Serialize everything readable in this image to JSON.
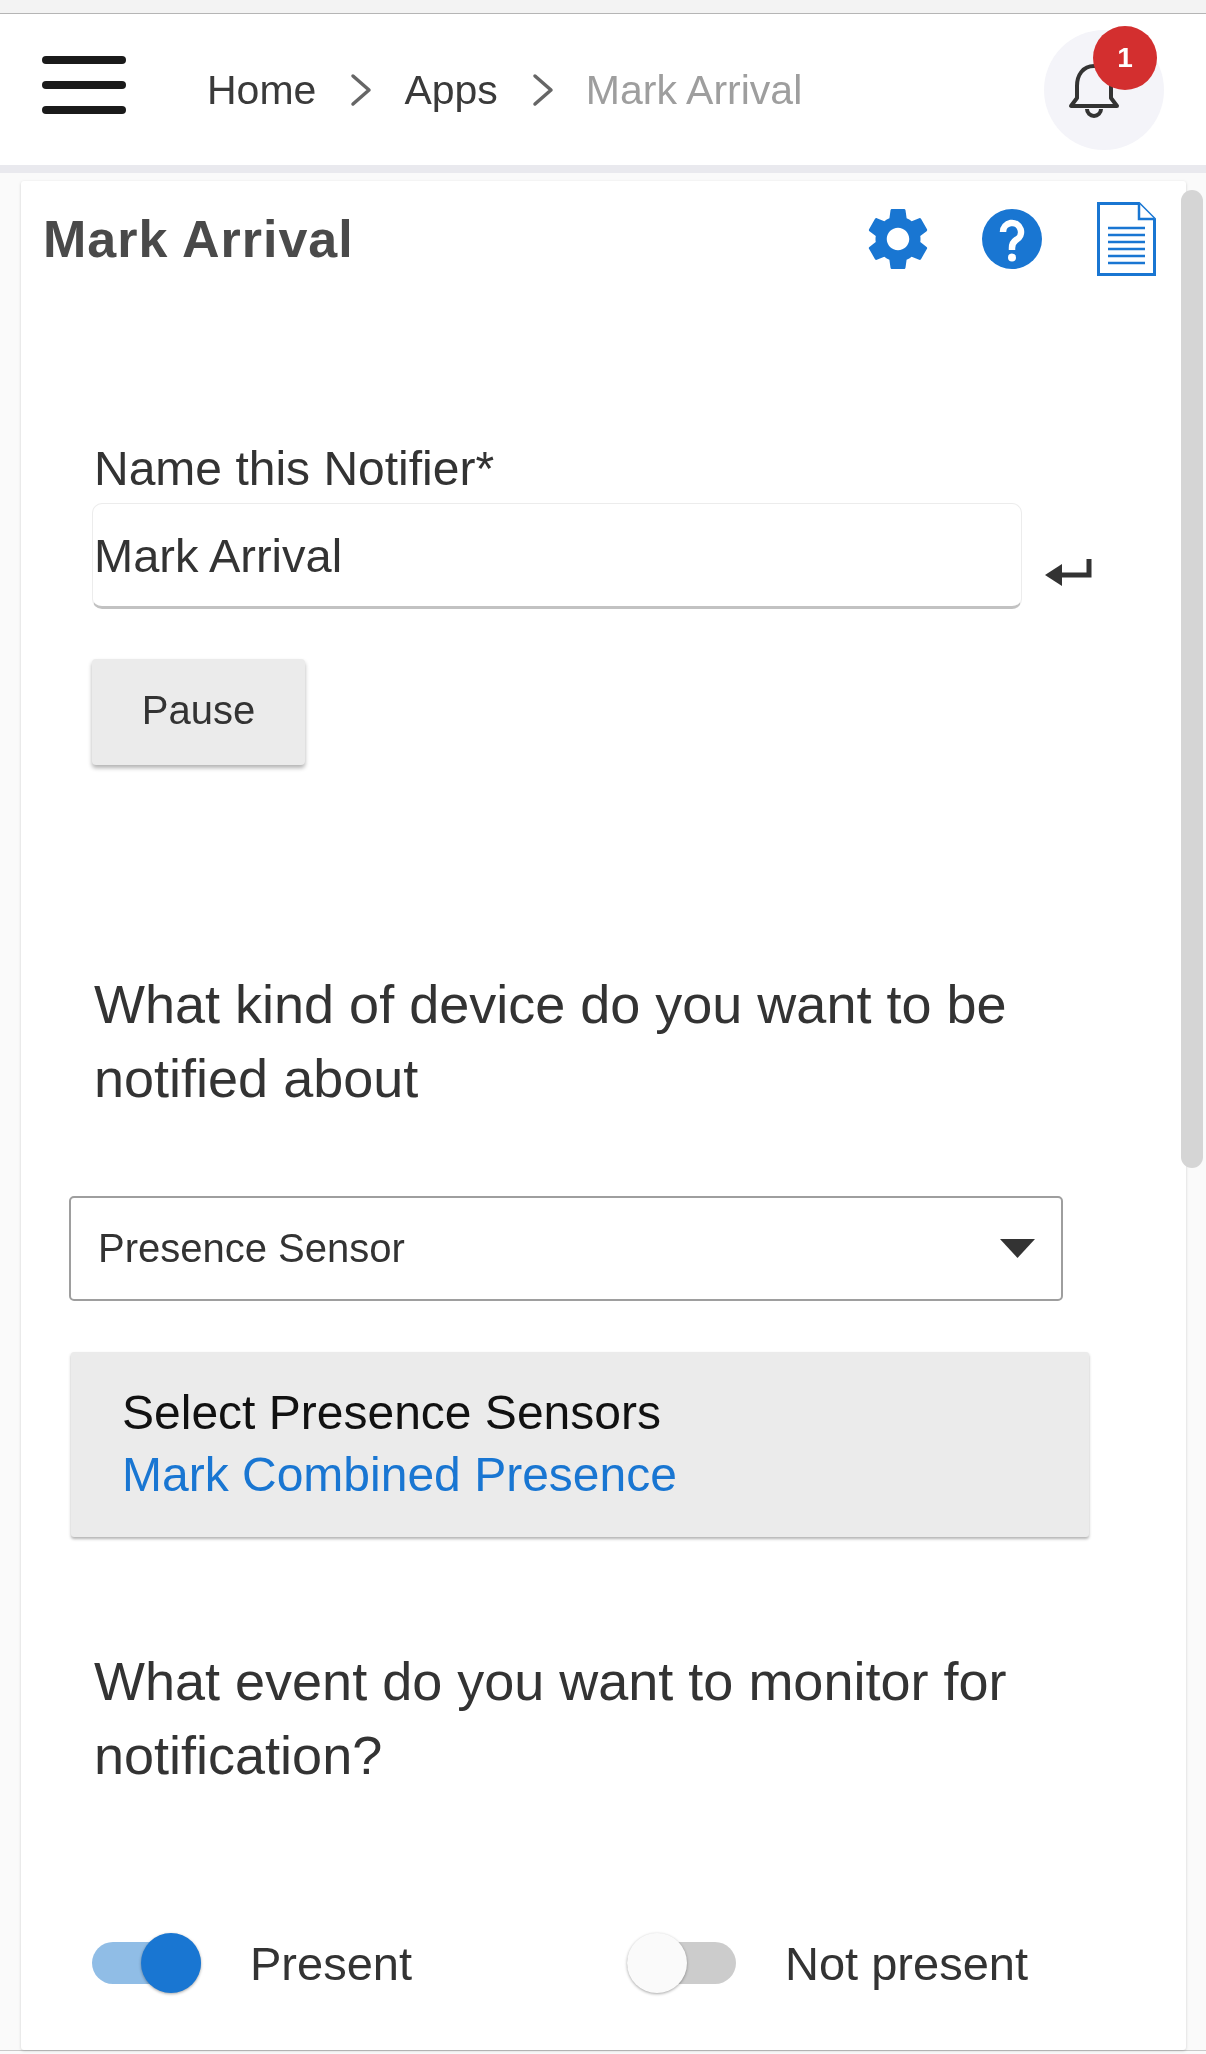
{
  "header": {
    "breadcrumb": [
      {
        "label": "Home",
        "current": false
      },
      {
        "label": "Apps",
        "current": false
      },
      {
        "label": "Mark Arrival",
        "current": true
      }
    ],
    "notifications": {
      "count": "1"
    }
  },
  "app": {
    "title": "Mark Arrival",
    "name_field": {
      "label": "Name this Notifier*",
      "value": "Mark Arrival"
    },
    "pause_button": {
      "label": "Pause"
    },
    "device_question": "What kind of device do you want to be notified about",
    "device_type": {
      "value": "Presence Sensor"
    },
    "sensor_picker": {
      "label": "Select Presence Sensors",
      "value": "Mark Combined Presence"
    },
    "event_question": "What event do you want to monitor for notification?",
    "events": [
      {
        "label": "Present",
        "on": true
      },
      {
        "label": "Not present",
        "on": false
      }
    ]
  }
}
